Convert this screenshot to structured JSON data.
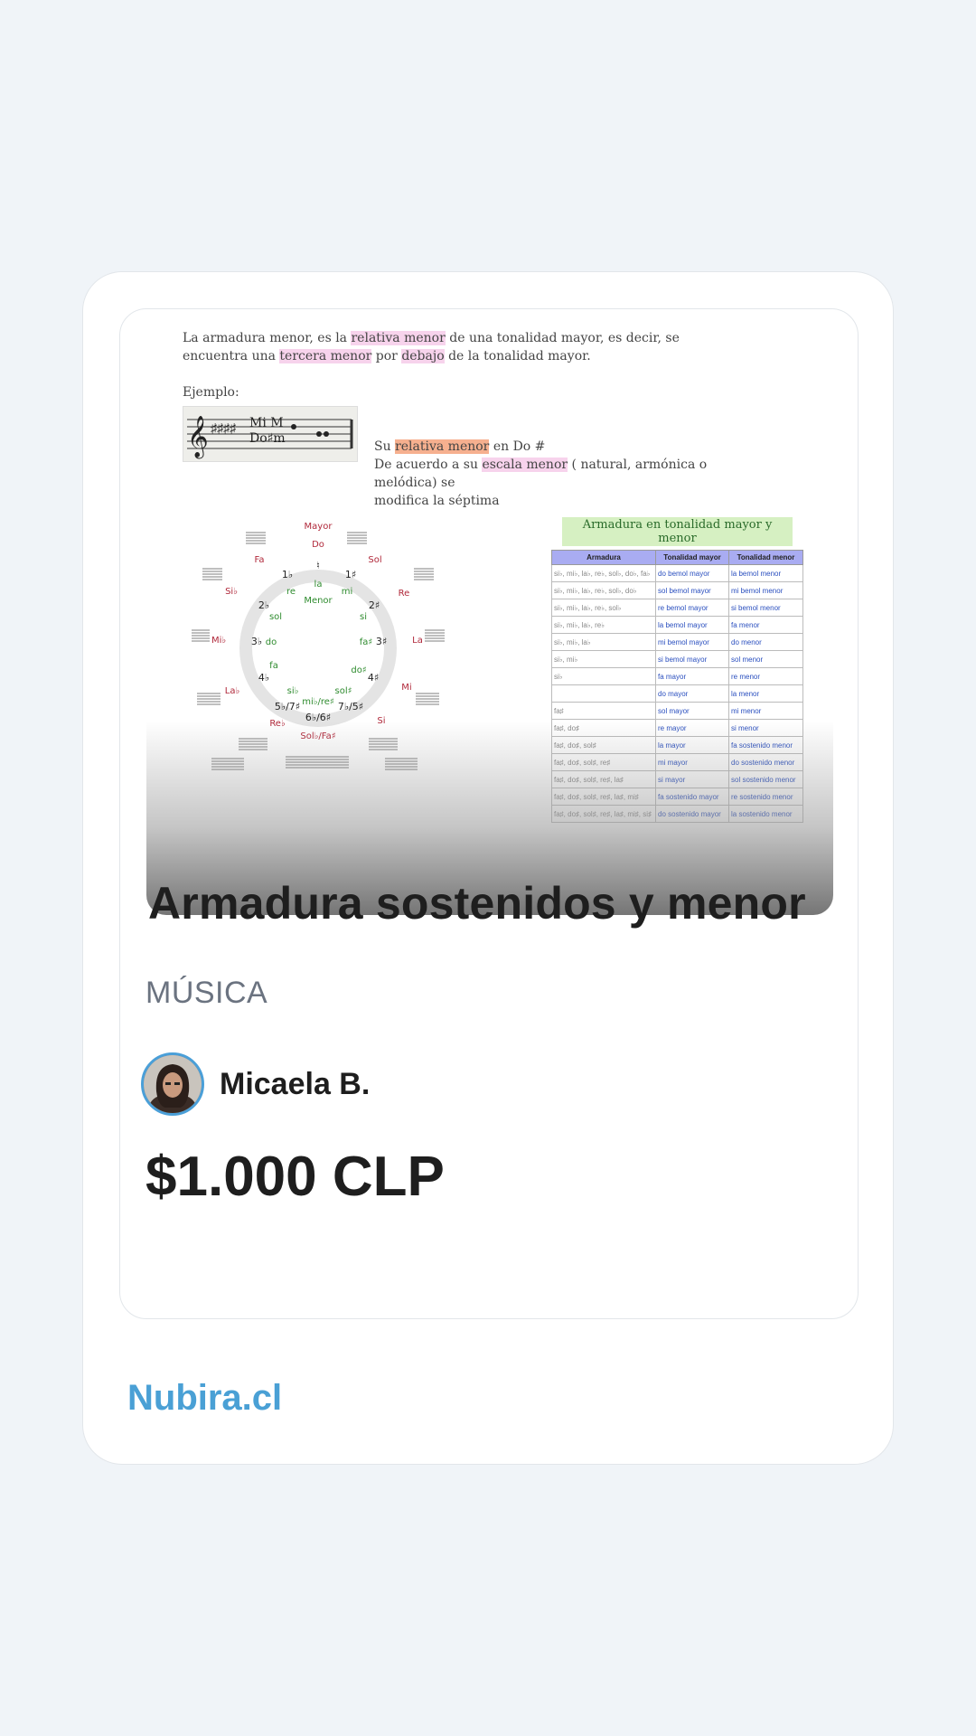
{
  "product": {
    "title": "Armadura sostenidos y menor",
    "category": "MÚSICA",
    "author_name": "Micaela B.",
    "price": "$1.000 CLP"
  },
  "brand": "Nubira.cl",
  "preview": {
    "intro_pre": "La armadura menor, es la ",
    "intro_hl1": "relativa menor",
    "intro_mid": " de una tonalidad mayor, es decir, se",
    "intro_line2_pre": "encuentra una ",
    "intro_hl2": "tercera menor",
    "intro_line2_mid": " por ",
    "intro_hl3": "debajo",
    "intro_line2_post": " de la tonalidad mayor.",
    "ejemplo": "Ejemplo:",
    "staff_top": "Mi M",
    "staff_bottom": "Do♯m",
    "note_pre": "Su ",
    "note_hl1": "relativa menor",
    "note_mid": " en Do #",
    "note2_pre": "De acuerdo a su ",
    "note2_hl": "escala menor",
    "note2_post": " ( natural, armónica o melódica) se",
    "note3": "modifica la séptima",
    "circle_center": "Menor",
    "circle_major_labels": [
      "Mayor",
      "Do",
      "Sol",
      "Re",
      "La",
      "Mi",
      "Si",
      "Sol♭/Fa♯",
      "Re♭",
      "La♭",
      "Mi♭",
      "Si♭",
      "Fa"
    ],
    "circle_minor_labels": [
      "la",
      "mi",
      "si",
      "fa♯",
      "do♯",
      "sol♯",
      "mi♭/re♯",
      "si♭",
      "fa",
      "do",
      "sol",
      "re"
    ],
    "circle_counts": [
      "♮",
      "1♯",
      "2♯",
      "3♯",
      "4♯",
      "5♭/7♯",
      "6♭/6♯",
      "7♭/5♯",
      "4♭",
      "3♭",
      "2♭",
      "1♭"
    ],
    "table_title": "Armadura en tonalidad mayor y menor",
    "table_headers": [
      "Armadura",
      "Tonalidad mayor",
      "Tonalidad menor"
    ],
    "table_rows": [
      [
        "si♭, mi♭, la♭, re♭, sol♭, do♭, fa♭",
        "do bemol mayor",
        "la bemol menor"
      ],
      [
        "si♭, mi♭, la♭, re♭, sol♭, do♭",
        "sol bemol mayor",
        "mi bemol menor"
      ],
      [
        "si♭, mi♭, la♭, re♭, sol♭",
        "re bemol mayor",
        "si bemol menor"
      ],
      [
        "si♭, mi♭, la♭, re♭",
        "la bemol mayor",
        "fa menor"
      ],
      [
        "si♭, mi♭, la♭",
        "mi bemol mayor",
        "do menor"
      ],
      [
        "si♭, mi♭",
        "si bemol mayor",
        "sol menor"
      ],
      [
        "si♭",
        "fa mayor",
        "re menor"
      ],
      [
        "",
        "do mayor",
        "la menor"
      ],
      [
        "fa♯",
        "sol mayor",
        "mi menor"
      ],
      [
        "fa♯, do♯",
        "re mayor",
        "si menor"
      ],
      [
        "fa♯, do♯, sol♯",
        "la mayor",
        "fa sostenido menor"
      ],
      [
        "fa♯, do♯, sol♯, re♯",
        "mi mayor",
        "do sostenido menor"
      ],
      [
        "fa♯, do♯, sol♯, re♯, la♯",
        "si mayor",
        "sol sostenido menor"
      ],
      [
        "fa♯, do♯, sol♯, re♯, la♯, mi♯",
        "fa sostenido mayor",
        "re sostenido menor"
      ],
      [
        "fa♯, do♯, sol♯, re♯, la♯, mi♯, si♯",
        "do sostenido mayor",
        "la sostenido menor"
      ]
    ]
  },
  "colors": {
    "brand": "#4aa0d5",
    "avatar_ring": "#4a9fd8",
    "table_header": "#a9acf2",
    "major_label": "#b0283a",
    "minor_label": "#2e8b2e"
  }
}
